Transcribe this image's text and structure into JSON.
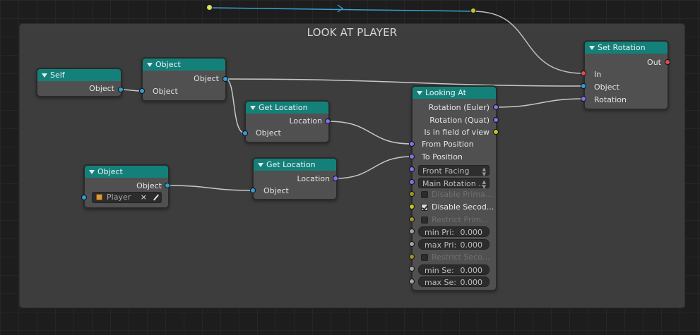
{
  "frame": {
    "title": "LOOK AT PLAYER"
  },
  "nodes": {
    "self": {
      "title": "Self",
      "outputs": [
        "Object"
      ]
    },
    "object_a": {
      "title": "Object",
      "outputs": [
        "Object"
      ],
      "inputs": [
        "Object"
      ]
    },
    "get_location_a": {
      "title": "Get Location",
      "outputs": [
        "Location"
      ],
      "inputs": [
        "Object"
      ]
    },
    "object_b": {
      "title": "Object",
      "outputs": [
        "Object"
      ],
      "object_field": {
        "value": "Player",
        "icon": "cube-icon"
      }
    },
    "get_location_b": {
      "title": "Get Location",
      "outputs": [
        "Location"
      ],
      "inputs": [
        "Object"
      ]
    },
    "looking_at": {
      "title": "Looking At",
      "outputs": [
        "Rotation (Euler)",
        "Rotation (Quat)",
        "Is in field of view"
      ],
      "inputs": [
        "From Position",
        "To Position"
      ],
      "dropdowns": [
        "Front Facing",
        "Main Rotation ..."
      ],
      "checks": [
        {
          "label": "Disable Prima...",
          "checked": false,
          "disabled": true
        },
        {
          "label": "Disable Secod...",
          "checked": true,
          "disabled": false
        },
        {
          "label": "Restrict Prim...",
          "checked": false,
          "disabled": true
        }
      ],
      "fields1": [
        {
          "label": "min Pri:",
          "value": "0.000"
        },
        {
          "label": "max Pri:",
          "value": "0.000"
        }
      ],
      "check2": {
        "label": "Restrict Seco...",
        "checked": false,
        "disabled": true
      },
      "fields2": [
        {
          "label": "min Se:",
          "value": "0.000"
        },
        {
          "label": "max Se:",
          "value": "0.000"
        }
      ]
    },
    "set_rotation": {
      "title": "Set Rotation",
      "outputs": [
        "Out"
      ],
      "inputs": [
        "In",
        "Object",
        "Rotation"
      ]
    }
  },
  "colors": {
    "node_header": "#13817a",
    "socket_object": "#2e9fd8",
    "socket_vector": "#7c74e6",
    "socket_bool": "#c9c12c",
    "socket_logic": "#d95050",
    "socket_float": "#a4a4a4"
  }
}
